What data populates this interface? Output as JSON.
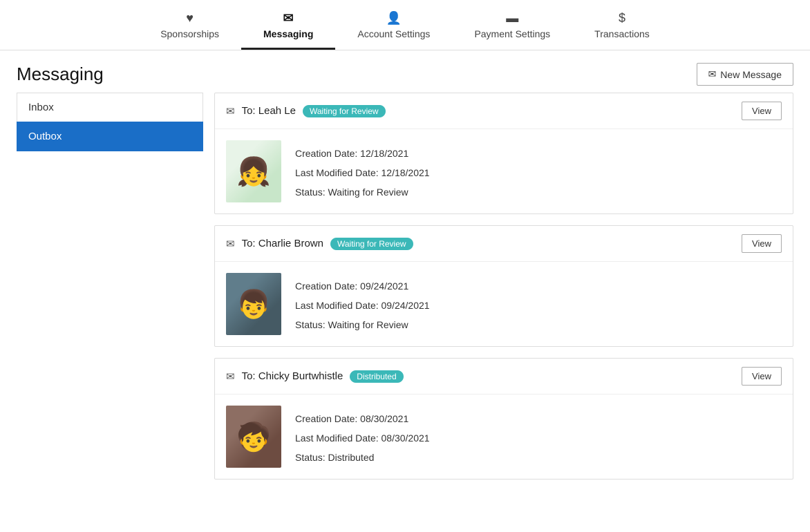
{
  "nav": {
    "items": [
      {
        "id": "sponsorships",
        "label": "Sponsorships",
        "icon": "♥",
        "active": false
      },
      {
        "id": "messaging",
        "label": "Messaging",
        "icon": "💬",
        "active": true
      },
      {
        "id": "account-settings",
        "label": "Account Settings",
        "icon": "👤",
        "active": false
      },
      {
        "id": "payment-settings",
        "label": "Payment Settings",
        "icon": "💳",
        "active": false
      },
      {
        "id": "transactions",
        "label": "Transactions",
        "icon": "$",
        "active": false
      }
    ]
  },
  "page": {
    "title": "Messaging",
    "new_message_label": "New Message"
  },
  "sidebar": {
    "items": [
      {
        "id": "inbox",
        "label": "Inbox",
        "active": false
      },
      {
        "id": "outbox",
        "label": "Outbox",
        "active": true
      }
    ]
  },
  "messages": [
    {
      "id": "msg-1",
      "to": "To: Leah Le",
      "badge_label": "Waiting for Review",
      "badge_type": "waiting",
      "view_label": "View",
      "avatar_class": "avatar-leah",
      "creation_date": "Creation Date: 12/18/2021",
      "last_modified": "Last Modified Date: 12/18/2021",
      "status": "Status: Waiting for Review"
    },
    {
      "id": "msg-2",
      "to": "To: Charlie Brown",
      "badge_label": "Waiting for Review",
      "badge_type": "waiting",
      "view_label": "View",
      "avatar_class": "avatar-charlie",
      "creation_date": "Creation Date: 09/24/2021",
      "last_modified": "Last Modified Date: 09/24/2021",
      "status": "Status: Waiting for Review"
    },
    {
      "id": "msg-3",
      "to": "To: Chicky Burtwhistle",
      "badge_label": "Distributed",
      "badge_type": "distributed",
      "view_label": "View",
      "avatar_class": "avatar-chicky",
      "creation_date": "Creation Date: 08/30/2021",
      "last_modified": "Last Modified Date: 08/30/2021",
      "status": "Status: Distributed"
    }
  ]
}
